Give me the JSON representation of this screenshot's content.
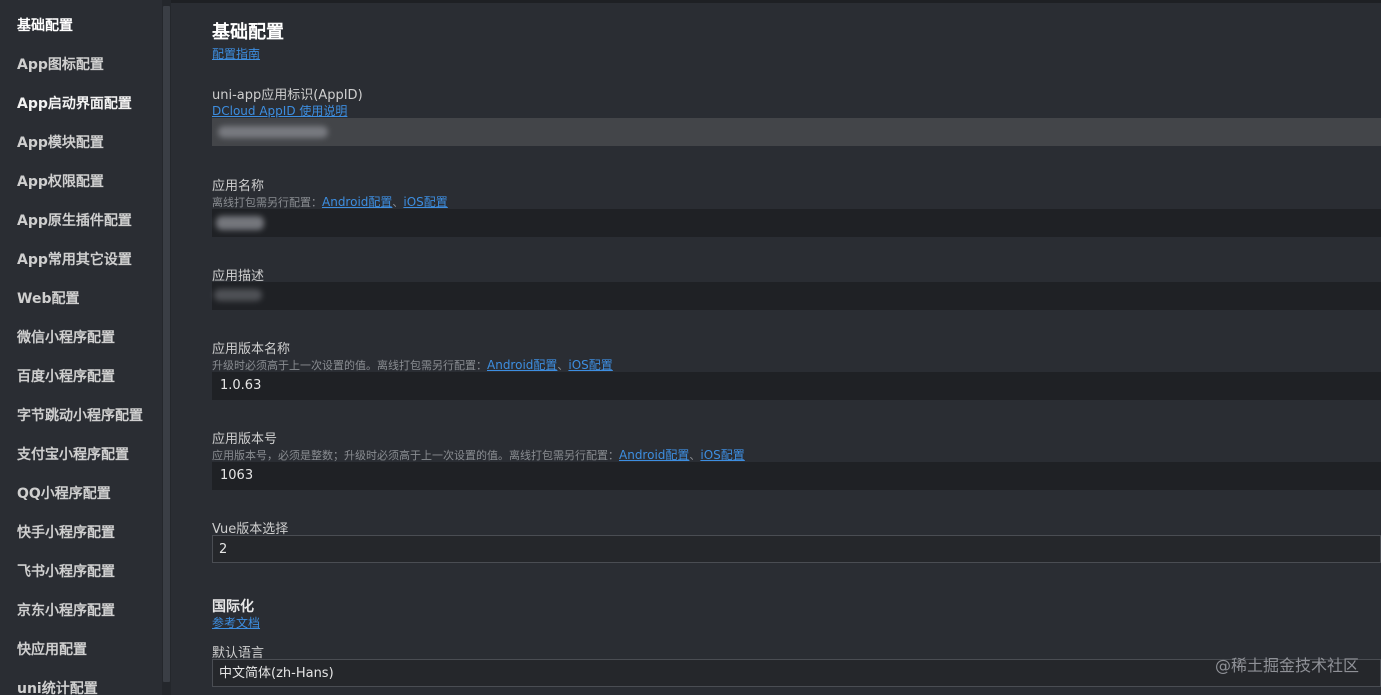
{
  "sidebar": {
    "items": [
      {
        "label": "基础配置"
      },
      {
        "label": "App图标配置"
      },
      {
        "label": "App启动界面配置"
      },
      {
        "label": "App模块配置"
      },
      {
        "label": "App权限配置"
      },
      {
        "label": "App原生插件配置"
      },
      {
        "label": "App常用其它设置"
      },
      {
        "label": "Web配置"
      },
      {
        "label": "微信小程序配置"
      },
      {
        "label": "百度小程序配置"
      },
      {
        "label": "字节跳动小程序配置"
      },
      {
        "label": "支付宝小程序配置"
      },
      {
        "label": "QQ小程序配置"
      },
      {
        "label": "快手小程序配置"
      },
      {
        "label": "飞书小程序配置"
      },
      {
        "label": "京东小程序配置"
      },
      {
        "label": "快应用配置"
      },
      {
        "label": "uni统计配置"
      }
    ]
  },
  "main": {
    "title": "基础配置",
    "guide_link": "配置指南",
    "appid": {
      "label": "uni-app应用标识(AppID)",
      "link": "DCloud AppID 使用说明"
    },
    "app_name": {
      "label": "应用名称",
      "desc": "离线打包需另行配置：",
      "link_android": "Android配置",
      "sep": "、",
      "link_ios": "iOS配置"
    },
    "app_desc": {
      "label": "应用描述"
    },
    "version_name": {
      "label": "应用版本名称",
      "desc": "升级时必须高于上一次设置的值。离线打包需另行配置：",
      "link_android": "Android配置",
      "sep": "、",
      "link_ios": "iOS配置",
      "value": "1.0.63"
    },
    "version_code": {
      "label": "应用版本号",
      "desc": "应用版本号，必须是整数；升级时必须高于上一次设置的值。离线打包需另行配置：",
      "link_android": "Android配置",
      "sep": "、",
      "link_ios": "iOS配置",
      "value": "1063"
    },
    "vue_version": {
      "label": "Vue版本选择",
      "value": "2"
    },
    "i18n": {
      "title": "国际化",
      "link": "参考文档",
      "default_lang_label": "默认语言",
      "default_lang_value": "中文简体(zh-Hans)"
    }
  },
  "watermark": "@稀土掘金技术社区"
}
